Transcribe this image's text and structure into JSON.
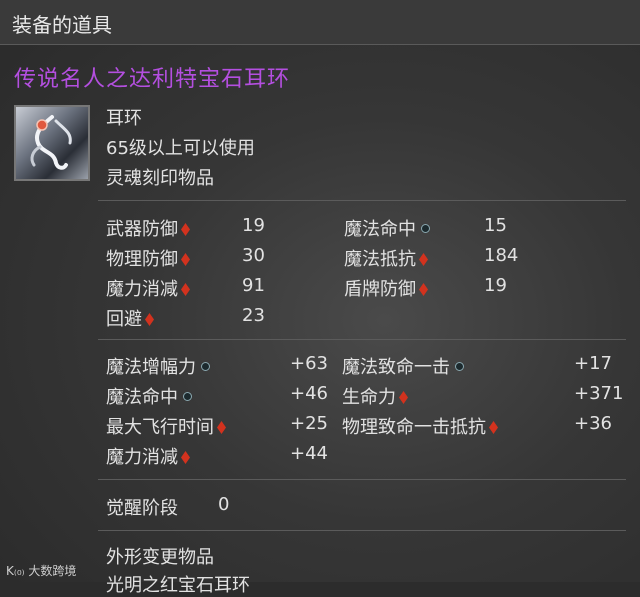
{
  "header": {
    "title": "装备的道具"
  },
  "item": {
    "name": "传说名人之达利特宝石耳环",
    "icon": "earring-icon",
    "type": "耳环",
    "level_req": "65级以上可以使用",
    "soulbound": "灵魂刻印物品"
  },
  "base_stats": {
    "left": [
      {
        "label": "武器防御",
        "icon": "red-diamond",
        "value": "19"
      },
      {
        "label": "物理防御",
        "icon": "red-diamond",
        "value": "30"
      },
      {
        "label": "魔力消减",
        "icon": "red-diamond",
        "value": "91"
      },
      {
        "label": "回避",
        "icon": "red-diamond",
        "value": "23"
      }
    ],
    "right": [
      {
        "label": "魔法命中",
        "icon": "grey-dot",
        "value": "15"
      },
      {
        "label": "魔法抵抗",
        "icon": "red-diamond",
        "value": "184"
      },
      {
        "label": "盾牌防御",
        "icon": "red-diamond",
        "value": "19"
      }
    ]
  },
  "bonus_stats": {
    "left": [
      {
        "label": "魔法增幅力",
        "icon": "grey-dot",
        "value": "+63"
      },
      {
        "label": "魔法命中",
        "icon": "grey-dot",
        "value": "+46"
      },
      {
        "label": "最大飞行时间",
        "icon": "red-diamond",
        "value": "+25"
      },
      {
        "label": "魔力消减",
        "icon": "red-diamond",
        "value": "+44"
      }
    ],
    "right": [
      {
        "label": "魔法致命一击",
        "icon": "grey-dot",
        "value": "+17"
      },
      {
        "label": "生命力",
        "icon": "red-diamond",
        "value": "+371"
      },
      {
        "label": "物理致命一击抵抗",
        "icon": "red-diamond",
        "value": "+36"
      }
    ]
  },
  "awakening": {
    "label": "觉醒阶段",
    "value": "0"
  },
  "appearance": {
    "line1": "外形变更物品",
    "line2": "光明之红宝石耳环"
  },
  "watermark": {
    "text": "大数跨境"
  },
  "colors": {
    "item_name": "#b44fe0",
    "diamond": "#d2321e"
  }
}
